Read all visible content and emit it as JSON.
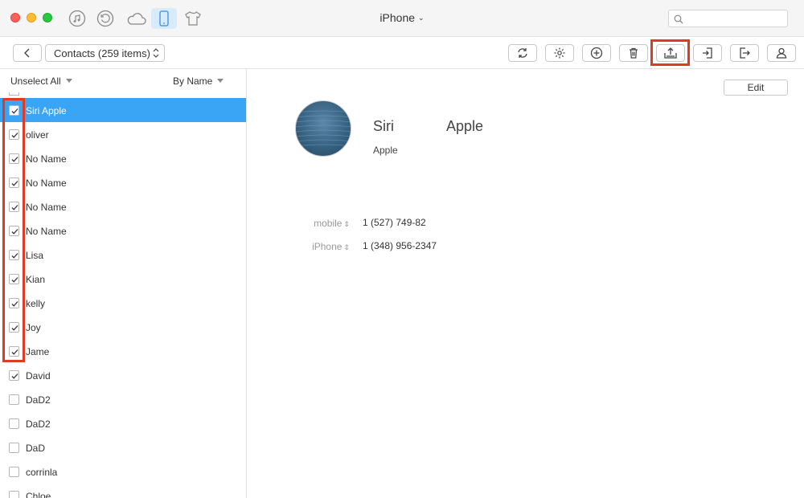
{
  "window": {
    "device_title": "iPhone",
    "search": {
      "placeholder": "",
      "value": ""
    }
  },
  "toolbar": {
    "category_label": "Contacts (259 items)",
    "tools": [
      "refresh-icon",
      "gear-icon",
      "add-icon",
      "trash-icon",
      "export-icon",
      "import-icon",
      "send-to-device-icon",
      "contact-icon"
    ]
  },
  "sidebar": {
    "unselect_label": "Unselect All",
    "sort_label": "By Name",
    "contacts": [
      {
        "name": "Siri Apple",
        "checked": true,
        "selected": true
      },
      {
        "name": "oliver",
        "checked": true,
        "selected": false
      },
      {
        "name": "No Name",
        "checked": true,
        "selected": false
      },
      {
        "name": "No Name",
        "checked": true,
        "selected": false
      },
      {
        "name": "No Name",
        "checked": true,
        "selected": false
      },
      {
        "name": "No Name",
        "checked": true,
        "selected": false
      },
      {
        "name": "Lisa",
        "checked": true,
        "selected": false
      },
      {
        "name": "Kian",
        "checked": true,
        "selected": false
      },
      {
        "name": "kelly",
        "checked": true,
        "selected": false
      },
      {
        "name": "Joy",
        "checked": true,
        "selected": false
      },
      {
        "name": "Jame",
        "checked": true,
        "selected": false
      },
      {
        "name": "David",
        "checked": true,
        "selected": false
      },
      {
        "name": "DaD2",
        "checked": false,
        "selected": false
      },
      {
        "name": "DaD2",
        "checked": false,
        "selected": false
      },
      {
        "name": "DaD",
        "checked": false,
        "selected": false
      },
      {
        "name": "corrinla",
        "checked": false,
        "selected": false
      },
      {
        "name": "Chloe",
        "checked": false,
        "selected": false
      }
    ]
  },
  "detail": {
    "edit_label": "Edit",
    "first_name": "Siri",
    "last_name": "Apple",
    "company": "Apple",
    "phones": [
      {
        "label": "mobile",
        "number": "1 (527) 749-82"
      },
      {
        "label": "iPhone",
        "number": "1 (348) 956-2347"
      }
    ]
  },
  "colors": {
    "selection": "#3aa4f5",
    "highlight": "#e03a25",
    "active_tab": "#d7ebfa"
  }
}
